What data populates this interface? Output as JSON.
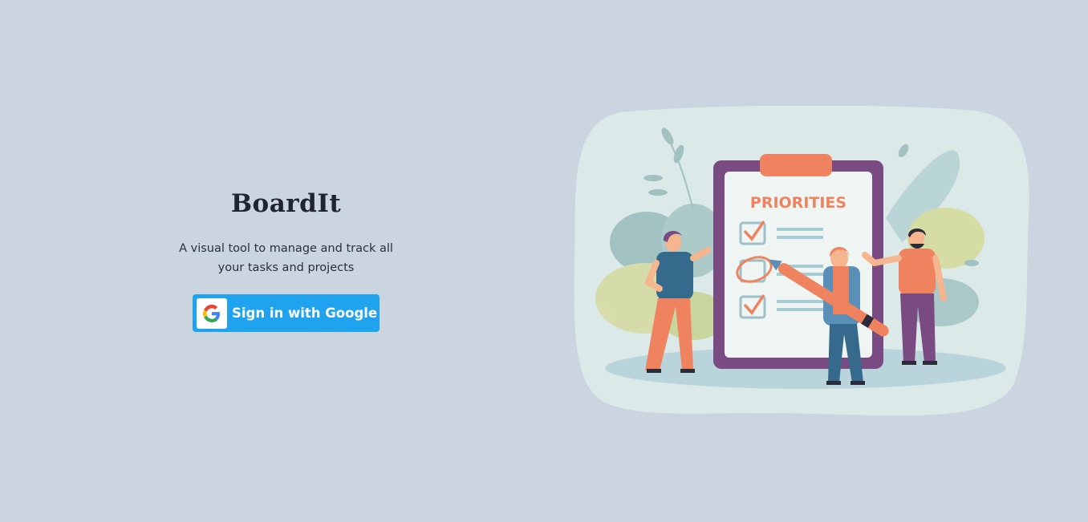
{
  "app": {
    "title": "BoardIt",
    "tagline": "A visual tool to manage and track all your tasks and projects"
  },
  "auth": {
    "google_button_label": "Sign in with Google",
    "google_icon": "google-g-icon"
  },
  "illustration": {
    "heading": "PRIORITIES",
    "subject": "people-with-priorities-checklist-illustration"
  },
  "colors": {
    "background": "#cbd5df",
    "button": "#1fa3ee",
    "accent_orange": "#ef8360",
    "clipboard_purple": "#7a4a82",
    "blob": "#dbe9e8"
  }
}
